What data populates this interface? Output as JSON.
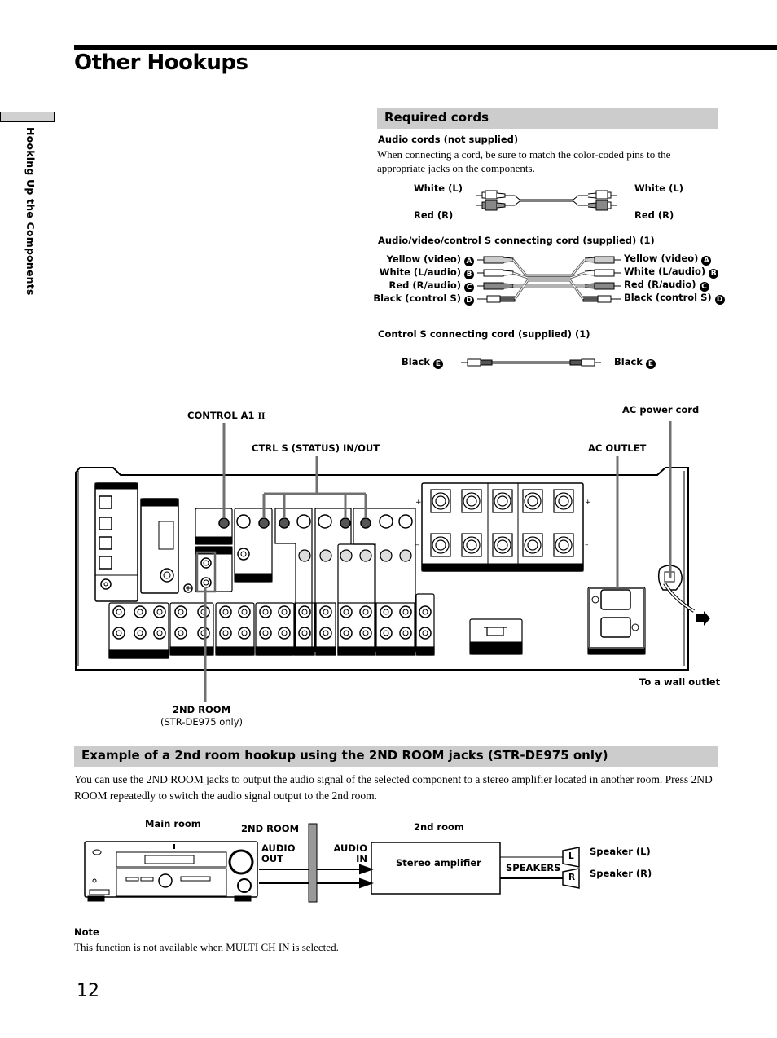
{
  "page": {
    "title": "Other Hookups",
    "side_tab_label": "Hooking Up the Components",
    "page_number": "12"
  },
  "required_cords": {
    "heading": "Required cords",
    "audio_cords": {
      "title": "Audio cords (not supplied)",
      "description": "When connecting a cord, be sure to match the color-coded pins to the appropriate jacks on the components.",
      "left_labels": [
        "White (L)",
        "Red (R)"
      ],
      "right_labels": [
        "White (L)",
        "Red (R)"
      ]
    },
    "av_cord": {
      "title": "Audio/video/control S connecting cord (supplied) (1)",
      "plugs": [
        {
          "label": "Yellow (video)",
          "marker": "A"
        },
        {
          "label": "White (L/audio)",
          "marker": "B"
        },
        {
          "label": "Red (R/audio)",
          "marker": "C"
        },
        {
          "label": "Black (control S)",
          "marker": "D"
        }
      ]
    },
    "control_s_cord": {
      "title": "Control S connecting cord (supplied) (1)",
      "left_label": "Black",
      "right_label": "Black",
      "marker": "E"
    }
  },
  "rear_panel": {
    "callouts": {
      "control_a1": "CONTROL A1",
      "control_a1_symbol": "II",
      "ctrl_s": "CTRL S (STATUS) IN/OUT",
      "ac_outlet": "AC OUTLET",
      "ac_power_cord": "AC power cord",
      "wall_outlet": "To a wall outlet",
      "second_room": "2ND ROOM",
      "second_room_note": "(STR-DE975 only)"
    }
  },
  "example": {
    "heading": "Example of a 2nd room hookup using the 2ND ROOM jacks (STR-DE975 only)",
    "description": "You can use the 2ND ROOM jacks to output the audio signal of the selected component to a stereo amplifier located in another room. Press 2ND ROOM repeatedly to switch the audio signal output to the 2nd room.",
    "diagram": {
      "main_room": "Main room",
      "second_room_jack": "2ND ROOM",
      "audio_out": [
        "AUDIO",
        "OUT"
      ],
      "audio_in": [
        "AUDIO",
        "IN"
      ],
      "second_room": "2nd room",
      "amplifier": "Stereo amplifier",
      "speakers": "SPEAKERS",
      "speaker_l_mark": "L",
      "speaker_r_mark": "R",
      "speaker_l": "Speaker (L)",
      "speaker_r": "Speaker (R)"
    }
  },
  "note": {
    "title": "Note",
    "text": "This function is not available when MULTI CH IN is selected."
  }
}
